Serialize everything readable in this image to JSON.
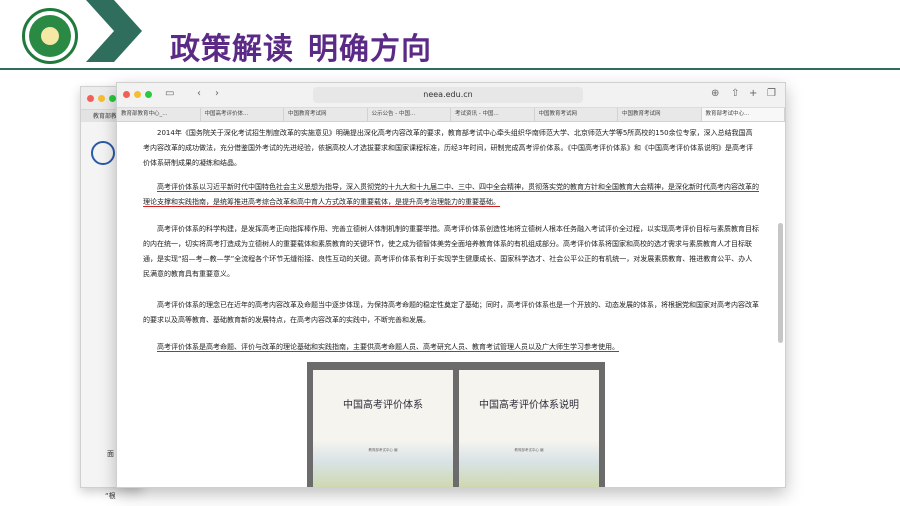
{
  "slide": {
    "title_part1": "政策解读",
    "title_part2": "明确方向",
    "accent_color": "#5b2a86",
    "rule_color": "#2f6e5d"
  },
  "logo": {
    "name": "school-logo-icon"
  },
  "browser": {
    "url": "neea.edu.cn",
    "tabs": [
      "教育部教育中心_...",
      "中国高考评价体...",
      "中国教育考试网",
      "公示公告 - 中国...",
      "考试资讯 - 中国...",
      "中国教育考试网",
      "中国教育考试网",
      "教育部考试中心..."
    ],
    "back_window_tab": "教育部教育中心_...",
    "back_window_text1": "面",
    "back_window_text2": "“根"
  },
  "article": {
    "p1": "2014年《国务院关于深化考试招生制度改革的实施意见》明确提出深化高考内容改革的要求，教育部考试中心牵头组织华南师范大学、北京师范大学等5所高校的150余位专家，深入总结我国高考内容改革的成功做法，充分借鉴国外考试的先进经验，依据高校人才选拔要求和国家课程标准，历经3年时间，研制完成高考评价体系。《中国高考评价体系》和《中国高考评价体系说明》是高考评价体系研制成果的凝练和结晶。",
    "p2": "高考评价体系以习近平新时代中国特色社会主义思想为指导，深入贯彻党的十九大和十九届二中、三中、四中全会精神，贯彻落实党的教育方针和全国教育大会精神，是深化新时代高考内容改革的理论支撑和实践指南，是统筹推进高考综合改革和高中育人方式改革的重要载体，是提升高考治理能力的重要基础。",
    "p3": "高考评价体系的科学构建，是发挥高考正向指挥棒作用、完善立德树人体制机制的重要举措。高考评价体系创造性地将立德树人根本任务融入考试评价全过程，以实现高考评价目标与素质教育目标的内在统一，切实将高考打造成为立德树人的重要载体和素质教育的关键环节，使之成为德智体美劳全面培养教育体系的有机组成部分。高考评价体系将国家和高校的选才需求与素质教育人才目标联通，是实现“招—考—教—学”全流程各个环节无缝衔接、良性互动的关键。高考评价体系有利于实现学生健康成长、国家科学选才、社会公平公正的有机统一，对发展素质教育、推进教育公平、办人民满意的教育具有重要意义。",
    "p4": "高考评价体系的理念已在近年的高考内容改革及命题当中逐步体现，为保持高考命题的稳定性奠定了基础；同时，高考评价体系也是一个开放的、动态发展的体系，将根据党和国家对高考内容改革的要求以及高等教育、基础教育新的发展特点，在高考内容改革的实践中，不断完善和发展。",
    "p5": "高考评价体系是高考命题、评价与改革的理论基础和实践指南，主要供高考命题人员、高考研究人员、教育考试管理人员以及广大师生学习参考使用。"
  },
  "books": [
    {
      "title": "中国高考评价体系",
      "publisher": "教育部考试中心 编"
    },
    {
      "title": "中国高考评价体系说明",
      "publisher": "教育部考试中心 编"
    }
  ]
}
